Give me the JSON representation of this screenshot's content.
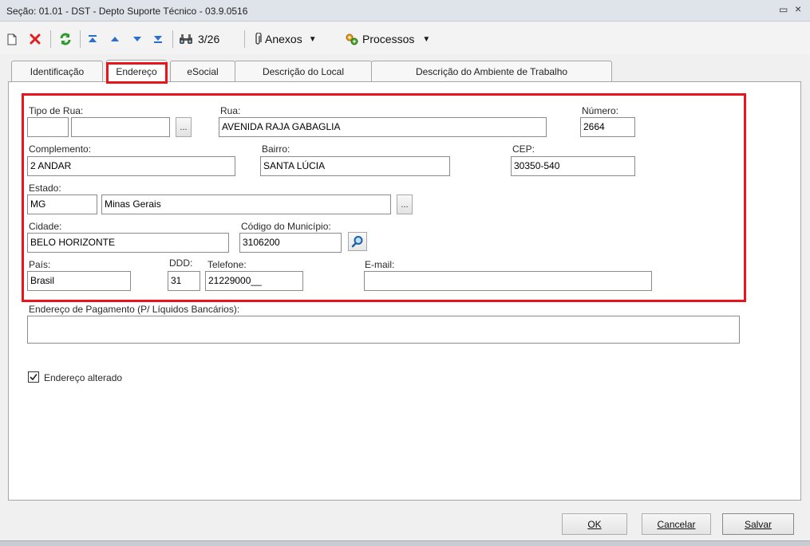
{
  "window": {
    "title": "Seção: 01.01 - DST - Depto Suporte Técnico - 03.9.0516",
    "restore_glyph": "▭",
    "close_glyph": "×"
  },
  "toolbar": {
    "record_counter": "3/26",
    "anexos_label": "Anexos",
    "processos_label": "Processos",
    "dropdown_glyph": "▼",
    "icons": [
      "new-document-icon",
      "delete-icon",
      "refresh-icon",
      "first-record-icon",
      "previous-record-icon",
      "next-record-icon",
      "last-record-icon",
      "binoculars-icon",
      "paperclip-icon",
      "processes-icon"
    ]
  },
  "tabs": [
    {
      "label": "Identificação"
    },
    {
      "label": "Endereço"
    },
    {
      "label": "eSocial"
    },
    {
      "label": "Descrição do Local"
    },
    {
      "label": "Descrição do Ambiente de Trabalho"
    }
  ],
  "form": {
    "tipo_de_rua": {
      "label": "Tipo de Rua:",
      "code": "",
      "description": ""
    },
    "rua": {
      "label": "Rua:",
      "value": "AVENIDA RAJA GABAGLIA"
    },
    "numero": {
      "label": "Número:",
      "value": "2664"
    },
    "complemento": {
      "label": "Complemento:",
      "value": "2 ANDAR"
    },
    "bairro": {
      "label": "Bairro:",
      "value": "SANTA LÚCIA"
    },
    "cep": {
      "label": "CEP:",
      "value": "30350-540"
    },
    "estado": {
      "label": "Estado:",
      "code": "MG",
      "name": "Minas Gerais"
    },
    "cidade": {
      "label": "Cidade:",
      "value": "BELO HORIZONTE"
    },
    "codigo_municipio": {
      "label": "Código do Município:",
      "value": "3106200"
    },
    "pais": {
      "label": "País:",
      "value": "Brasil"
    },
    "ddd": {
      "label": "DDD:",
      "value": "31"
    },
    "telefone": {
      "label": "Telefone:",
      "value": "21229000__"
    },
    "email": {
      "label": "E-mail:",
      "value": ""
    },
    "endereco_pagamento": {
      "label": "Endereço de Pagamento (P/ Líquidos Bancários):",
      "value": ""
    },
    "endereco_alterado": {
      "label": "Endereço alterado",
      "checked": true
    },
    "lookup_glyph": "..."
  },
  "footer": {
    "ok_label": "OK",
    "cancelar_label": "Cancelar",
    "salvar_label": "Salvar"
  },
  "colors": {
    "highlight_red": "#e8151a",
    "delete_red": "#e02020",
    "refresh_green": "#2a9a2a",
    "nav_blue": "#2a6fd0"
  }
}
